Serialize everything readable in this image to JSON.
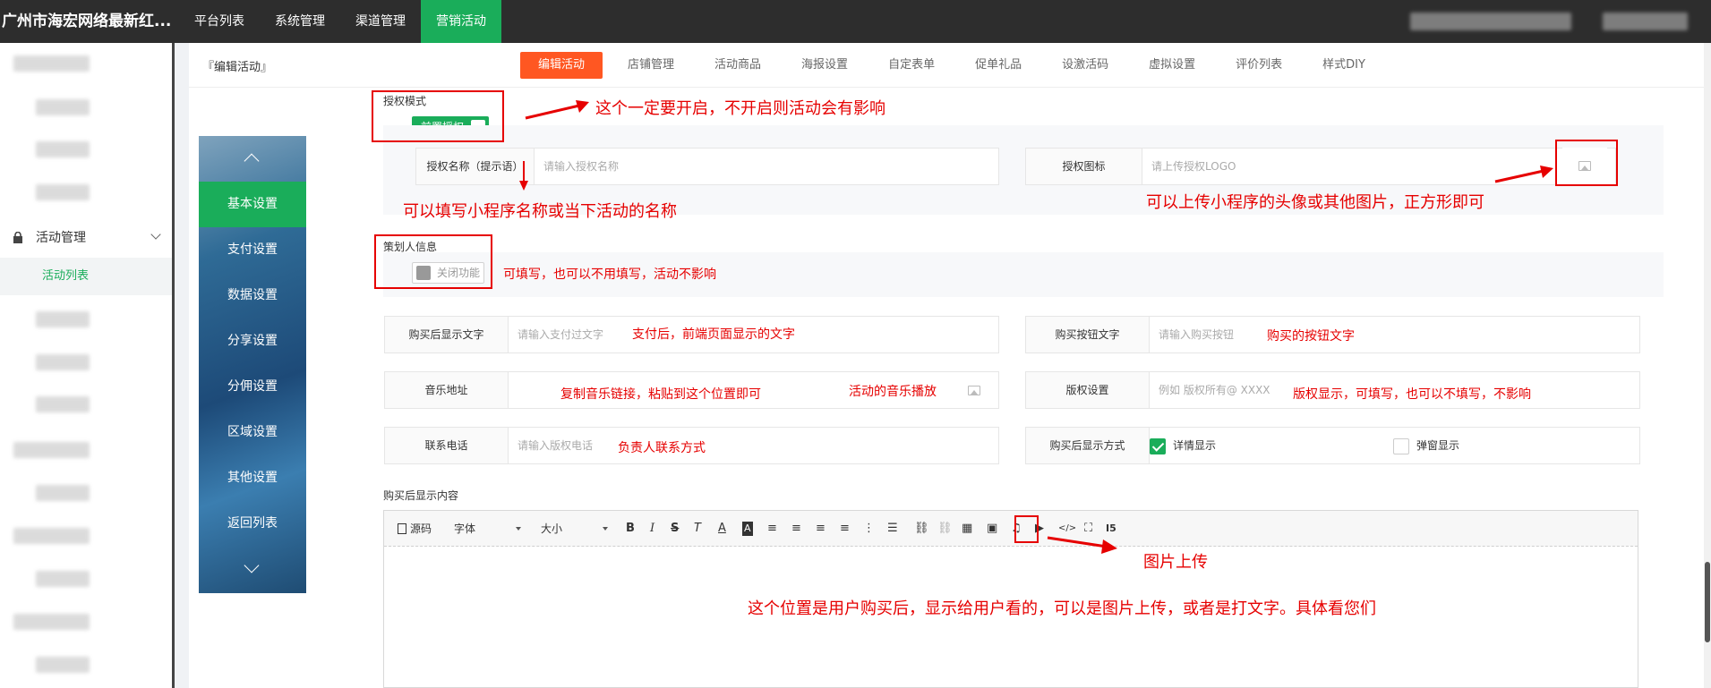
{
  "topbar": {
    "brand": "广州市海宏网络最新红...",
    "nav": [
      "平台列表",
      "系统管理",
      "渠道管理",
      "营销活动"
    ],
    "active_nav": "营销活动"
  },
  "sidebar": {
    "group_label": "活动管理",
    "active_item": "活动列表"
  },
  "page": {
    "title": "『编辑活动』",
    "tabs": [
      "编辑活动",
      "店铺管理",
      "活动商品",
      "海报设置",
      "自定表单",
      "促单礼品",
      "设激活码",
      "虚拟设置",
      "评价列表",
      "样式DIY"
    ]
  },
  "vertical_nav": [
    "基本设置",
    "支付设置",
    "数据设置",
    "分享设置",
    "分佣设置",
    "区域设置",
    "其他设置",
    "返回列表"
  ],
  "form": {
    "auth_mode_label": "授权模式",
    "auth_switch": "前置授权",
    "auth_name_label": "授权名称（提示语）",
    "auth_name_placeholder": "请输入授权名称",
    "auth_icon_label": "授权图标",
    "auth_icon_placeholder": "请上传授权LOGO",
    "planner_label": "策划人信息",
    "planner_switch": "关闭功能",
    "after_pay_text_label": "购买后显示文字",
    "after_pay_text_placeholder": "请输入支付过文字",
    "buy_button_label": "购买按钮文字",
    "buy_button_placeholder": "请输入购买按钮",
    "music_label": "音乐地址",
    "copyright_label": "版权设置",
    "copyright_placeholder": "例如 版权所有@ XXXX",
    "phone_label": "联系电话",
    "phone_placeholder": "请输入版权电话",
    "display_mode_label": "购买后显示方式",
    "display_mode_options": [
      "详情显示",
      "弹窗显示"
    ],
    "display_mode_selected": "详情显示",
    "content_label": "购买后显示内容"
  },
  "editor": {
    "source": "源码",
    "font": "字体",
    "size": "大小"
  },
  "annotations": {
    "auth_mode": "这个一定要开启，不开启则活动会有影响",
    "auth_name": "可以填写小程序名称或当下活动的名称",
    "auth_icon": "可以上传小程序的头像或其他图片，正方形即可",
    "planner": "可填写，也可以不用填写，活动不影响",
    "after_pay": "支付后，前端页面显示的文字",
    "buy_button": "购买的按钮文字",
    "music_url": "复制音乐链接，粘贴到这个位置即可",
    "music_play": "活动的音乐播放",
    "copyright": "版权显示，可填写，也可以不填写，不影响",
    "phone": "负责人联系方式",
    "image_upload": "图片上传",
    "content": "这个位置是用户购买后，显示给用户看的，可以是图片上传，或者是打文字。具体看您们"
  },
  "colors": {
    "primary_green": "#1aad5a",
    "tab_active": "#ff5722",
    "annotation_red": "#e60000",
    "topbar": "#2d2d2d"
  }
}
